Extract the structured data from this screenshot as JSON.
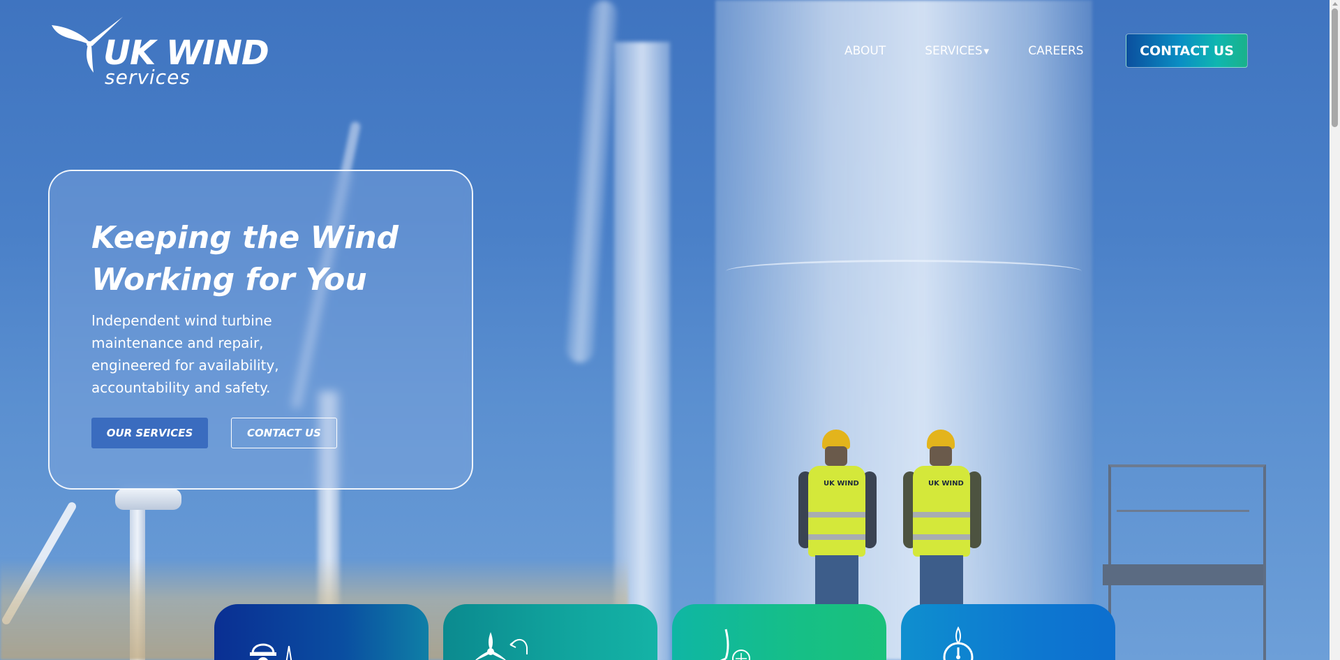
{
  "brand": {
    "title": "UK WIND",
    "subtitle": "services"
  },
  "nav": {
    "items": [
      {
        "label": "ABOUT"
      },
      {
        "label": "SERVICES",
        "has_dropdown": true,
        "caret": "▾"
      },
      {
        "label": "CAREERS"
      }
    ],
    "cta_label": "CONTACT US"
  },
  "hero": {
    "title_line1": "Keeping the Wind",
    "title_line2": "Working for You",
    "description_lines": [
      "Independent wind turbine",
      "maintenance and repair,",
      "engineered for availability,",
      "accountability and safety."
    ],
    "primary_button": "OUR SERVICES",
    "secondary_button": "CONTACT US"
  },
  "worker_vest_text": "UK WIND",
  "service_cards": [
    {
      "icon": "hard-hat-icon"
    },
    {
      "icon": "turbine-rotor-return-icon"
    },
    {
      "icon": "turbine-blade-icon"
    },
    {
      "icon": "nacelle-gauge-icon"
    }
  ],
  "colors": {
    "sky": "#4a80c8",
    "cta_gradient_start": "#0b4f9e",
    "cta_gradient_end": "#1ab28a",
    "primary_button": "#3a6cbf",
    "card_1": "#0a2f93",
    "card_2": "#11a59e",
    "card_3": "#16bf86",
    "card_4": "#0d78d0"
  }
}
